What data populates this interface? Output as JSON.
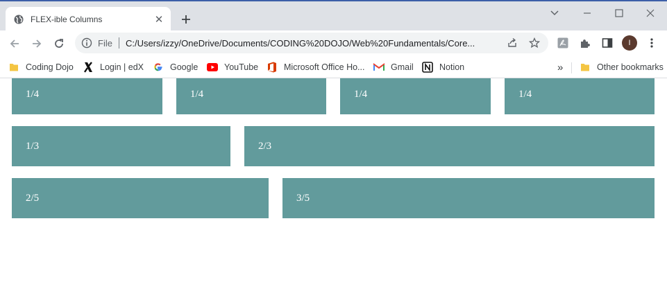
{
  "browser": {
    "tab_title": "FLEX-ible Columns",
    "address": {
      "scheme": "File",
      "url": "C:/Users/izzy/OneDrive/Documents/CODING%20DOJO/Web%20Fundamentals/Core..."
    },
    "profile_initial": "I",
    "bookmarks": [
      {
        "label": "Coding Dojo",
        "icon": "folder-icon"
      },
      {
        "label": "Login | edX",
        "icon": "edx-icon"
      },
      {
        "label": "Google",
        "icon": "google-icon"
      },
      {
        "label": "YouTube",
        "icon": "youtube-icon"
      },
      {
        "label": "Microsoft Office Ho...",
        "icon": "office-icon"
      },
      {
        "label": "Gmail",
        "icon": "gmail-icon"
      },
      {
        "label": "Notion",
        "icon": "notion-icon"
      }
    ],
    "overflow_label": "»",
    "other_bookmarks": "Other bookmarks"
  },
  "colors": {
    "cell_bg": "#629b9c",
    "cell_text": "#ffffff"
  },
  "rows": [
    {
      "cells": [
        "1/4",
        "1/4",
        "1/4",
        "1/4"
      ]
    },
    {
      "cells": [
        "1/3",
        "2/3"
      ]
    },
    {
      "cells": [
        "2/5",
        "3/5"
      ]
    }
  ]
}
